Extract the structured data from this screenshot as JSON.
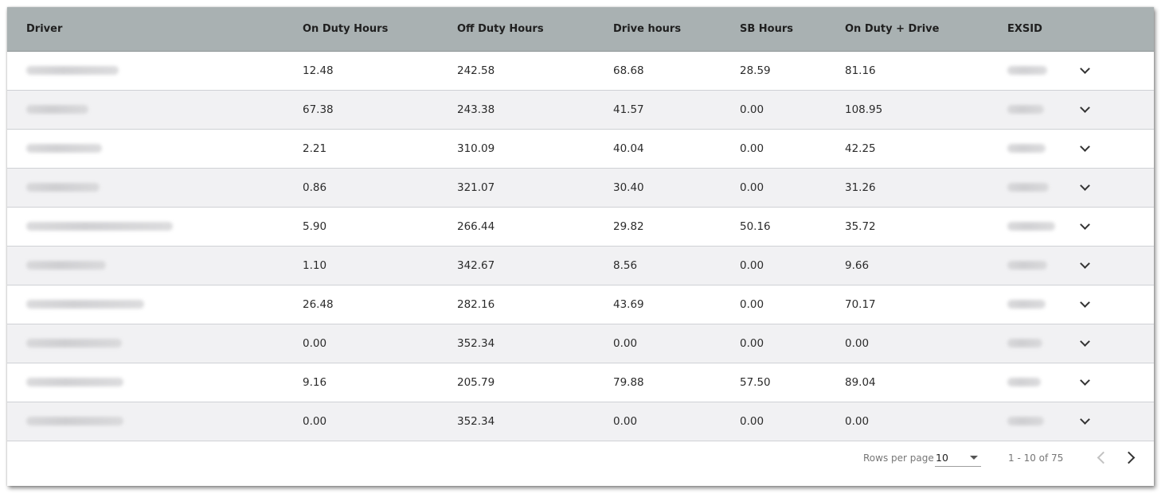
{
  "table": {
    "columns": [
      "Driver",
      "On Duty Hours",
      "Off Duty Hours",
      "Drive hours",
      "SB Hours",
      "On Duty + Drive",
      "EXSID"
    ],
    "rows": [
      {
        "on_duty": "12.48",
        "off_duty": "242.58",
        "drive": "68.68",
        "sb": "28.59",
        "on_drive": "81.16"
      },
      {
        "on_duty": "67.38",
        "off_duty": "243.38",
        "drive": "41.57",
        "sb": "0.00",
        "on_drive": "108.95"
      },
      {
        "on_duty": "2.21",
        "off_duty": "310.09",
        "drive": "40.04",
        "sb": "0.00",
        "on_drive": "42.25"
      },
      {
        "on_duty": "0.86",
        "off_duty": "321.07",
        "drive": "30.40",
        "sb": "0.00",
        "on_drive": "31.26"
      },
      {
        "on_duty": "5.90",
        "off_duty": "266.44",
        "drive": "29.82",
        "sb": "50.16",
        "on_drive": "35.72"
      },
      {
        "on_duty": "1.10",
        "off_duty": "342.67",
        "drive": "8.56",
        "sb": "0.00",
        "on_drive": "9.66"
      },
      {
        "on_duty": "26.48",
        "off_duty": "282.16",
        "drive": "43.69",
        "sb": "0.00",
        "on_drive": "70.17"
      },
      {
        "on_duty": "0.00",
        "off_duty": "352.34",
        "drive": "0.00",
        "sb": "0.00",
        "on_drive": "0.00"
      },
      {
        "on_duty": "9.16",
        "off_duty": "205.79",
        "drive": "79.88",
        "sb": "57.50",
        "on_drive": "89.04"
      },
      {
        "on_duty": "0.00",
        "off_duty": "352.34",
        "drive": "0.00",
        "sb": "0.00",
        "on_drive": "0.00"
      }
    ]
  },
  "pagination": {
    "rows_per_page_label": "Rows per page",
    "rows_per_page_value": "10",
    "range_label": "1 - 10 of 75"
  },
  "icons": {
    "row_expand": "chevron-down-icon",
    "prev": "chevron-left-icon",
    "next": "chevron-right-icon",
    "select_caret": "caret-down-icon"
  },
  "colors": {
    "header_bg": "#a9b1b2",
    "row_alt_bg": "#f1f1f3",
    "row_border": "#cfd1d5"
  }
}
